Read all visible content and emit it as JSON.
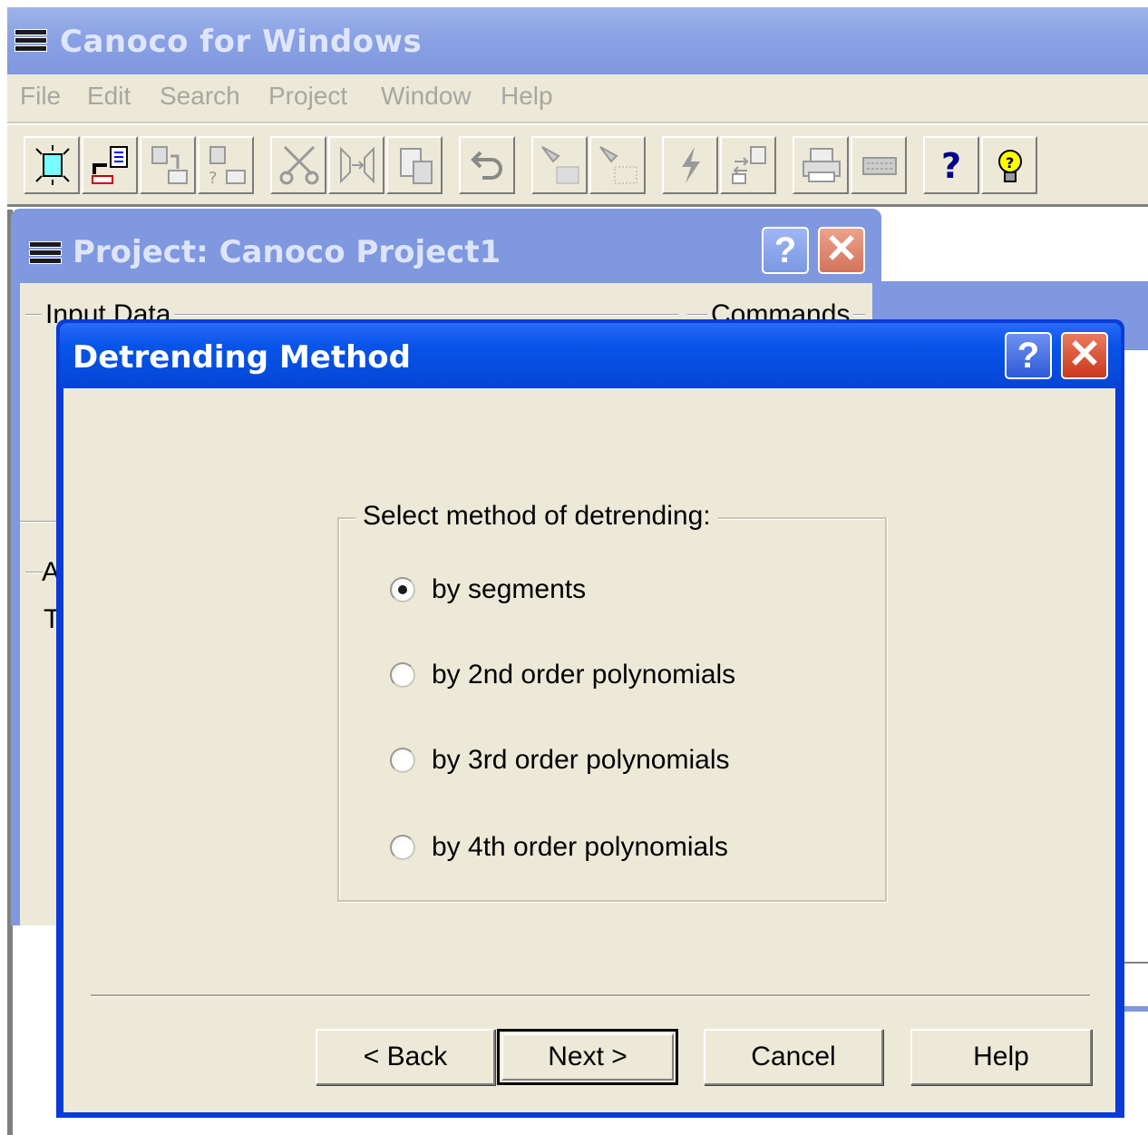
{
  "app": {
    "title": "Canoco for Windows",
    "menu": [
      "File",
      "Edit",
      "Search",
      "Project",
      "Window",
      "Help"
    ],
    "toolbar_icons": [
      "new-project-icon",
      "open-project-icon",
      "copy-data-icon",
      "paste-data-icon",
      "cut-icon",
      "split-icon",
      "paste-icon",
      "undo-icon",
      "filter-icon",
      "filter-grid-icon",
      "run-icon",
      "export-icon",
      "print-icon",
      "preview-icon",
      "help-icon",
      "tip-icon"
    ]
  },
  "project_window": {
    "title": "Project: Canoco Project1",
    "group_input_label": "Input Data",
    "group_commands_label": "Commands",
    "clipped_text_1": "A",
    "clipped_text_2": "T"
  },
  "dialog": {
    "title": "Detrending Method",
    "help_glyph": "?",
    "close_glyph": "✕",
    "group_label": "Select method of detrending:",
    "options": [
      {
        "label": "by segments",
        "checked": true
      },
      {
        "label": "by 2nd order polynomials",
        "checked": false
      },
      {
        "label": "by 3rd order polynomials",
        "checked": false
      },
      {
        "label": "by 4th order polynomials",
        "checked": false
      }
    ],
    "buttons": {
      "back": "< Back",
      "next": "Next >",
      "cancel": "Cancel",
      "help": "Help"
    }
  },
  "colors": {
    "dialog_titlebar": "#0854e8",
    "inactive_titlebar": "#7f98df",
    "window_face": "#ece9d8"
  }
}
